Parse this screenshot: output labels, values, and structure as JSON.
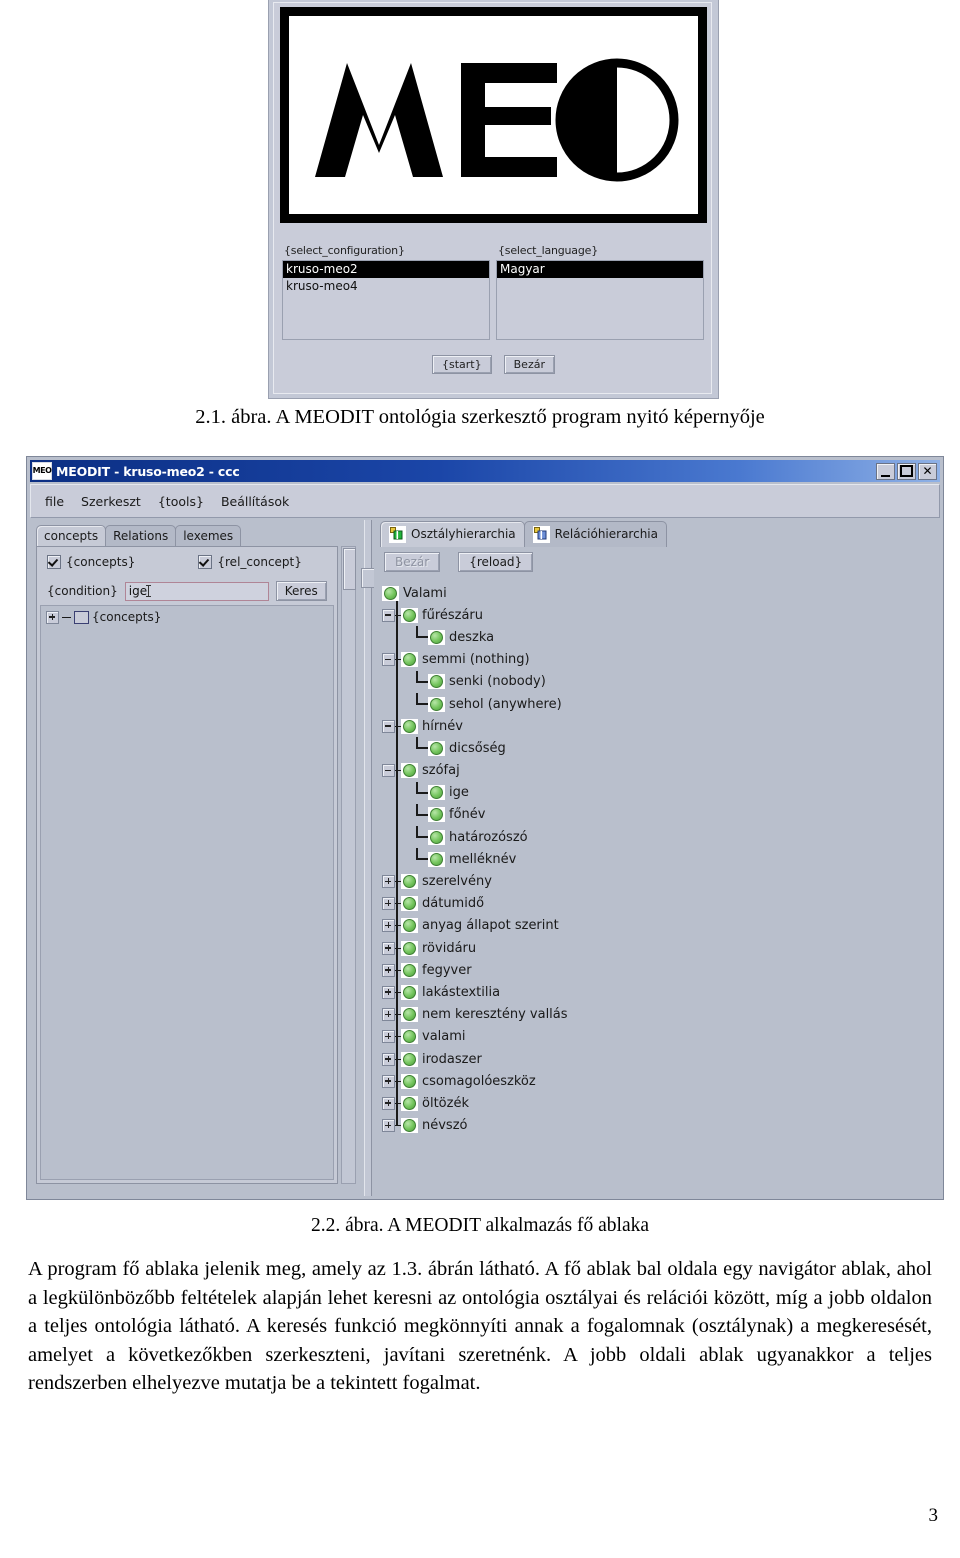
{
  "figure1": {
    "name": "meodit-splash-screen",
    "logo_text": "MEO",
    "config": {
      "label": "{select_configuration}",
      "options": [
        "kruso-meo2",
        "kruso-meo4"
      ],
      "selected": "kruso-meo2"
    },
    "language": {
      "label": "{select_language}",
      "options": [
        "Magyar"
      ],
      "selected": "Magyar"
    },
    "buttons": {
      "start": "{start}",
      "close": "Bezár"
    }
  },
  "caption1": "2.1. ábra. A MEODIT ontológia szerkesztő program nyitó képernyője",
  "caption2": "2.2. ábra. A MEODIT alkalmazás fő ablaka",
  "figure2": {
    "window": {
      "title": "MEODIT - kruso-meo2 - ccc",
      "icon_label": "MEO",
      "minimize": "minimize-icon",
      "maximize": "maximize-icon",
      "close": "✕"
    },
    "menu": [
      "file",
      "Szerkeszt",
      "{tools}",
      "Beállítások"
    ],
    "left_panel": {
      "tabs": [
        {
          "label": "concepts",
          "active": true
        },
        {
          "label": "Relations",
          "active": false
        },
        {
          "label": "lexemes",
          "active": false
        }
      ],
      "checkboxes": [
        {
          "label": "{concepts}",
          "checked": true
        },
        {
          "label": "{rel_concept}",
          "checked": true
        }
      ],
      "condition_label": "{condition}",
      "condition_value": "ige",
      "search_button": "Keres",
      "tree_root": "{concepts}"
    },
    "right_panel": {
      "tabs": [
        {
          "label": "Osztályhierarchia",
          "active": true,
          "icon": "class-hierarchy-icon"
        },
        {
          "label": "Relációhierarchia",
          "active": false,
          "icon": "relation-hierarchy-icon"
        }
      ],
      "toolbar": [
        {
          "label": "Bezár",
          "disabled": true
        },
        {
          "label": "{reload}",
          "disabled": false
        }
      ],
      "tree": [
        {
          "label": "Valami",
          "depth": 0,
          "toggle": "none",
          "rail": false
        },
        {
          "label": "fűrészáru",
          "depth": 1,
          "toggle": "minus",
          "rail": true
        },
        {
          "label": "deszka",
          "depth": 2,
          "toggle": "none",
          "rail": true
        },
        {
          "label": "semmi (nothing)",
          "depth": 1,
          "toggle": "minus",
          "rail": true
        },
        {
          "label": "senki (nobody)",
          "depth": 2,
          "toggle": "none",
          "rail": true
        },
        {
          "label": "sehol (anywhere)",
          "depth": 2,
          "toggle": "none",
          "rail": true
        },
        {
          "label": "hírnév",
          "depth": 1,
          "toggle": "minus",
          "rail": true
        },
        {
          "label": "dicsőség",
          "depth": 2,
          "toggle": "none",
          "rail": true
        },
        {
          "label": "szófaj",
          "depth": 1,
          "toggle": "minus",
          "rail": true
        },
        {
          "label": "ige",
          "depth": 2,
          "toggle": "none",
          "rail": true
        },
        {
          "label": "főnév",
          "depth": 2,
          "toggle": "none",
          "rail": true
        },
        {
          "label": "határozószó",
          "depth": 2,
          "toggle": "none",
          "rail": true
        },
        {
          "label": "melléknév",
          "depth": 2,
          "toggle": "none",
          "rail": true
        },
        {
          "label": "szerelvény",
          "depth": 1,
          "toggle": "plus",
          "rail": true
        },
        {
          "label": "dátumidő",
          "depth": 1,
          "toggle": "plus",
          "rail": true
        },
        {
          "label": "anyag állapot szerint",
          "depth": 1,
          "toggle": "plus",
          "rail": true
        },
        {
          "label": "rövidáru",
          "depth": 1,
          "toggle": "plus",
          "rail": true
        },
        {
          "label": "fegyver",
          "depth": 1,
          "toggle": "plus",
          "rail": true
        },
        {
          "label": "lakástextilia",
          "depth": 1,
          "toggle": "plus",
          "rail": true
        },
        {
          "label": "nem keresztény vallás",
          "depth": 1,
          "toggle": "plus",
          "rail": true
        },
        {
          "label": "valami",
          "depth": 1,
          "toggle": "plus",
          "rail": true
        },
        {
          "label": "irodaszer",
          "depth": 1,
          "toggle": "plus",
          "rail": true
        },
        {
          "label": "csomagolóeszköz",
          "depth": 1,
          "toggle": "plus",
          "rail": true
        },
        {
          "label": "öltözék",
          "depth": 1,
          "toggle": "plus",
          "rail": true
        },
        {
          "label": "névszó",
          "depth": 1,
          "toggle": "plus",
          "rail": true
        }
      ]
    }
  },
  "body_paragraph": "A program fő ablaka jelenik meg, amely az 1.3. ábrán látható. A fő ablak bal oldala egy navigátor ablak, ahol a legkülönbözőbb feltételek alapján lehet keresni az ontológia osztályai és relációi között, míg a jobb oldalon a teljes ontológia látható. A keresés funkció megkönnyíti annak a fogalomnak (osztálynak) a megkeresését, amelyet a következőkben szerkeszteni, javítani szeretnénk. A jobb oldali ablak ugyanakkor a teljes rendszerben elhelyezve mutatja be a tekintett fogalmat.",
  "page_number": "3",
  "colors": {
    "titlebar_start": "#0b2e83",
    "titlebar_end": "#8fb1e6",
    "window_face": "#c9ccd9",
    "panel_face": "#b9bfcc",
    "node_green": "#72c45b",
    "input_border": "#b08596"
  }
}
